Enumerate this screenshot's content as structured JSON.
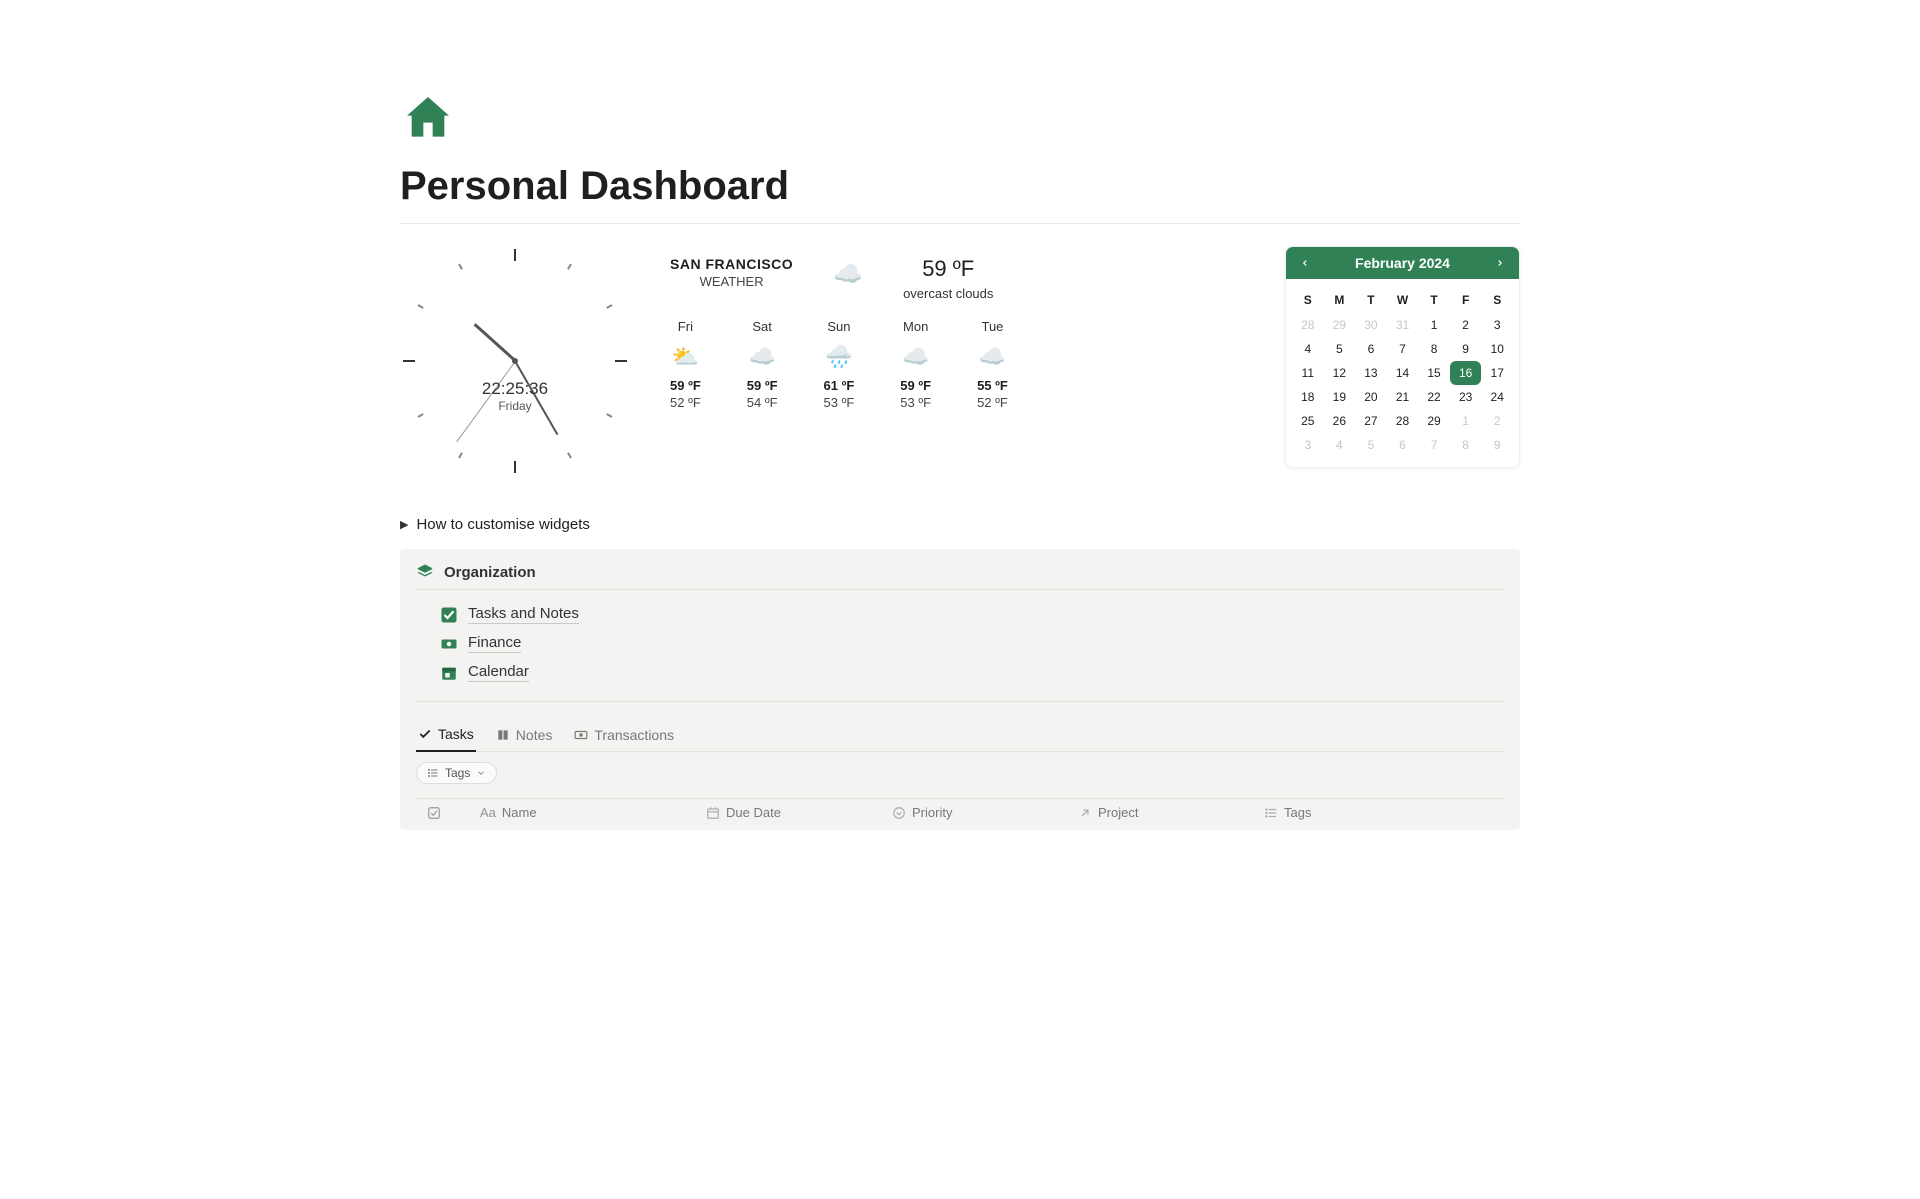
{
  "page": {
    "title": "Personal Dashboard"
  },
  "clock": {
    "time": "22:25:36",
    "day": "Friday"
  },
  "weather": {
    "city": "SAN FRANCISCO",
    "subtitle": "WEATHER",
    "current_temp": "59 ºF",
    "current_desc": "overcast clouds",
    "forecast": [
      {
        "day": "Fri",
        "hi": "59 ºF",
        "lo": "52 ºF"
      },
      {
        "day": "Sat",
        "hi": "59 ºF",
        "lo": "54 ºF"
      },
      {
        "day": "Sun",
        "hi": "61 ºF",
        "lo": "53 ºF"
      },
      {
        "day": "Mon",
        "hi": "59 ºF",
        "lo": "53 ºF"
      },
      {
        "day": "Tue",
        "hi": "55 ºF",
        "lo": "52 ºF"
      }
    ]
  },
  "calendar": {
    "month_label": "February 2024",
    "dow": [
      "S",
      "M",
      "T",
      "W",
      "T",
      "F",
      "S"
    ],
    "cells": [
      {
        "n": "28",
        "muted": true
      },
      {
        "n": "29",
        "muted": true
      },
      {
        "n": "30",
        "muted": true
      },
      {
        "n": "31",
        "muted": true
      },
      {
        "n": "1"
      },
      {
        "n": "2"
      },
      {
        "n": "3"
      },
      {
        "n": "4"
      },
      {
        "n": "5"
      },
      {
        "n": "6"
      },
      {
        "n": "7"
      },
      {
        "n": "8"
      },
      {
        "n": "9"
      },
      {
        "n": "10"
      },
      {
        "n": "11"
      },
      {
        "n": "12"
      },
      {
        "n": "13"
      },
      {
        "n": "14"
      },
      {
        "n": "15"
      },
      {
        "n": "16",
        "today": true
      },
      {
        "n": "17"
      },
      {
        "n": "18"
      },
      {
        "n": "19"
      },
      {
        "n": "20"
      },
      {
        "n": "21"
      },
      {
        "n": "22"
      },
      {
        "n": "23"
      },
      {
        "n": "24"
      },
      {
        "n": "25"
      },
      {
        "n": "26"
      },
      {
        "n": "27"
      },
      {
        "n": "28"
      },
      {
        "n": "29"
      },
      {
        "n": "1",
        "muted": true
      },
      {
        "n": "2",
        "muted": true
      },
      {
        "n": "3",
        "muted": true
      },
      {
        "n": "4",
        "muted": true
      },
      {
        "n": "5",
        "muted": true
      },
      {
        "n": "6",
        "muted": true
      },
      {
        "n": "7",
        "muted": true
      },
      {
        "n": "8",
        "muted": true
      },
      {
        "n": "9",
        "muted": true
      }
    ]
  },
  "toggle": {
    "label": "How to customise widgets"
  },
  "organization": {
    "title": "Organization",
    "links": [
      {
        "label": "Tasks and Notes",
        "icon": "check"
      },
      {
        "label": "Finance",
        "icon": "money"
      },
      {
        "label": "Calendar",
        "icon": "calendar"
      }
    ],
    "tabs": [
      {
        "label": "Tasks",
        "active": true
      },
      {
        "label": "Notes",
        "active": false
      },
      {
        "label": "Transactions",
        "active": false
      }
    ],
    "tags_chip": "Tags",
    "columns": {
      "name": "Name",
      "due": "Due Date",
      "priority": "Priority",
      "project": "Project",
      "tags": "Tags"
    }
  },
  "colors": {
    "accent": "#308256"
  }
}
